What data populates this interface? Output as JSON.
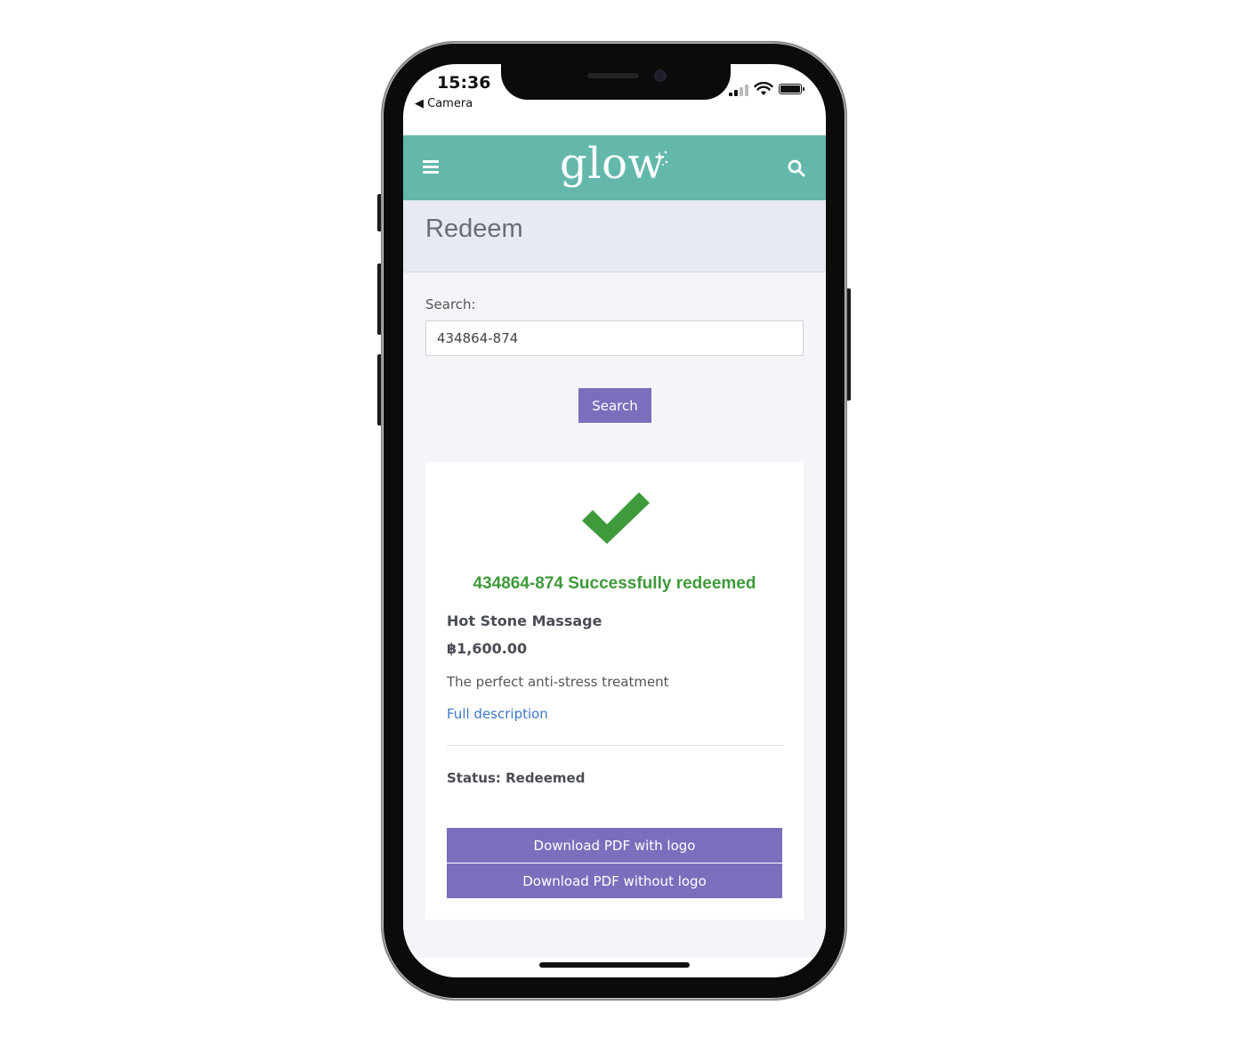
{
  "status_bar": {
    "time": "15:36",
    "back_label": "Camera"
  },
  "header": {
    "logo_text": "glow",
    "menu_icon": "hamburger-menu-icon",
    "search_icon": "search-icon",
    "header_color": "#63b8ab"
  },
  "page": {
    "title": "Redeem"
  },
  "search": {
    "label": "Search:",
    "value": "434864-874",
    "button_label": "Search"
  },
  "result": {
    "icon": "checkmark-icon",
    "success_message": "434864-874 Successfully redeemed",
    "product_name": "Hot Stone Massage",
    "price": "฿1,600.00",
    "description": "The perfect anti-stress treatment",
    "full_description_link": "Full description",
    "status": "Status: Redeemed",
    "download_with_logo": "Download PDF with logo",
    "download_without_logo": "Download PDF without logo",
    "success_color": "#3e9a3a",
    "button_color": "#7a6fbd"
  }
}
